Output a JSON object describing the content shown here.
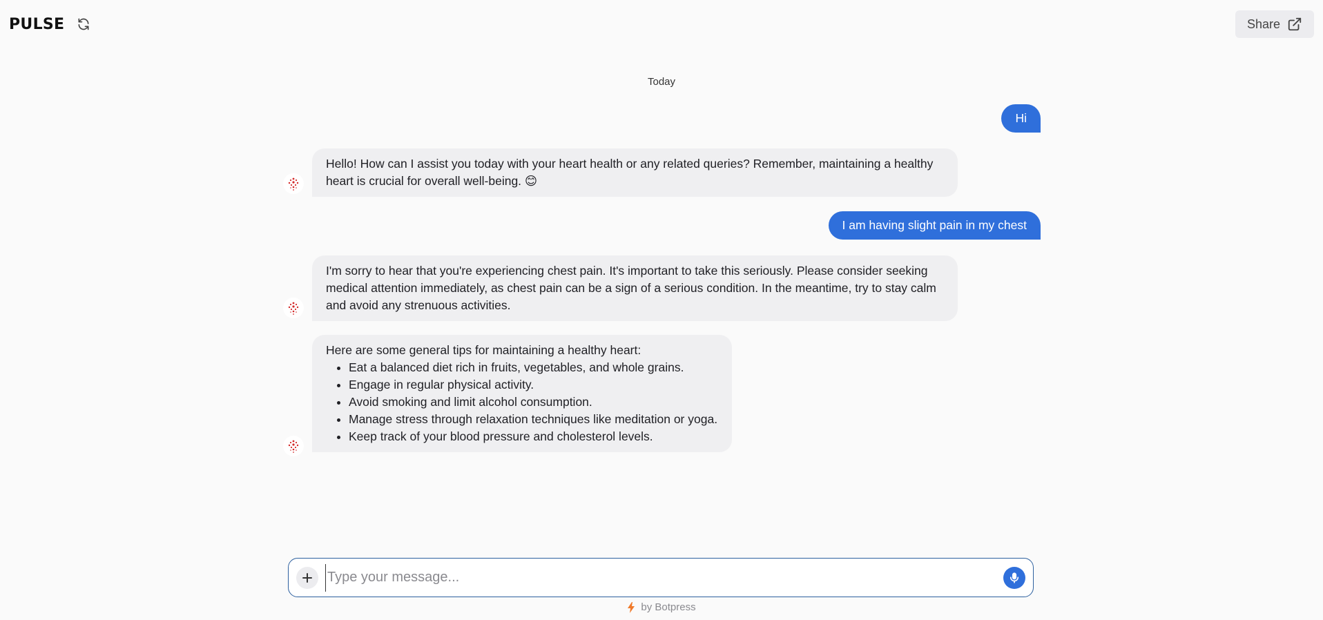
{
  "header": {
    "title": "PULSE",
    "refresh_icon": "refresh-icon",
    "share_label": "Share",
    "share_icon": "external-link-icon"
  },
  "conversation": {
    "day_separator": "Today",
    "messages": [
      {
        "role": "user",
        "text": "Hi"
      },
      {
        "role": "bot",
        "text": "Hello! How can I assist you today with your heart health or any related queries? Remember, maintaining a healthy heart is crucial for overall well-being. 😊"
      },
      {
        "role": "user",
        "text": "I am having slight pain in my chest"
      },
      {
        "role": "bot",
        "text": "I'm sorry to hear that you're experiencing chest pain. It's important to take this seriously. Please consider seeking medical attention immediately, as chest pain can be a sign of a serious condition. In the meantime, try to stay calm and avoid any strenuous activities."
      },
      {
        "role": "bot",
        "intro": "Here are some general tips for maintaining a healthy heart:",
        "tips": [
          "Eat a balanced diet rich in fruits, vegetables, and whole grains.",
          "Engage in regular physical activity.",
          "Avoid smoking and limit alcohol consumption.",
          "Manage stress through relaxation techniques like meditation or yoga.",
          "Keep track of your blood pressure and cholesterol levels."
        ]
      }
    ]
  },
  "composer": {
    "placeholder": "Type your message...",
    "value": "",
    "plus_icon": "plus-icon",
    "mic_icon": "microphone-icon"
  },
  "footer": {
    "powered_by": "by Botpress",
    "icon": "lightning-icon"
  },
  "colors": {
    "accent": "#2f6fdb",
    "bot_bubble": "#efeff1",
    "background": "#fafafa"
  }
}
